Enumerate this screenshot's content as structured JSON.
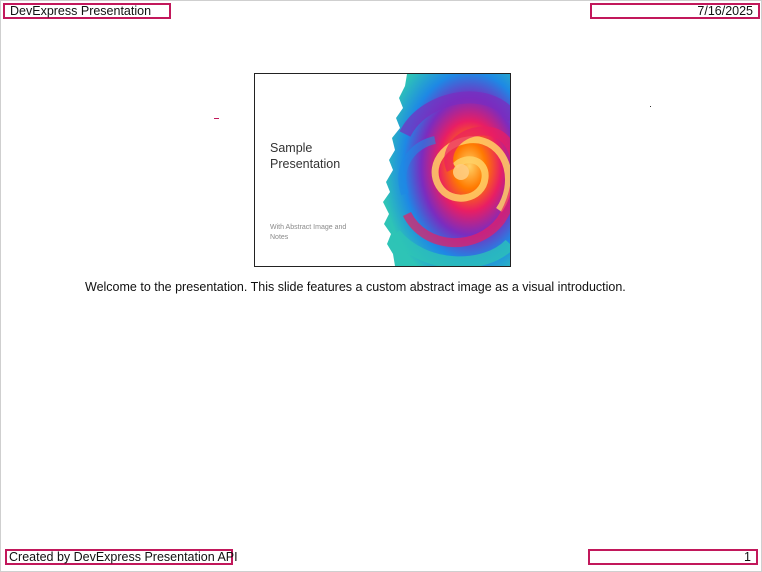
{
  "header": {
    "left_text": "DevExpress Presentation",
    "right_text": "7/16/2025"
  },
  "slide": {
    "title": "Sample\nPresentation",
    "subtitle": "With Abstract Image and\nNotes",
    "image_icon": "abstract-swirl-image"
  },
  "notes": {
    "text": "Welcome to the presentation. This slide features a custom abstract image as a visual introduction."
  },
  "footer": {
    "left_text": "Created by DevExpress Presentation API",
    "page_number": "1"
  },
  "colors": {
    "header_footer_border": "#c2185b",
    "swirl_colors": [
      "#3b2a7a",
      "#7b2cbf",
      "#e91e63",
      "#ff7a00",
      "#ffd166",
      "#2ec4b6",
      "#1e88e5"
    ]
  }
}
